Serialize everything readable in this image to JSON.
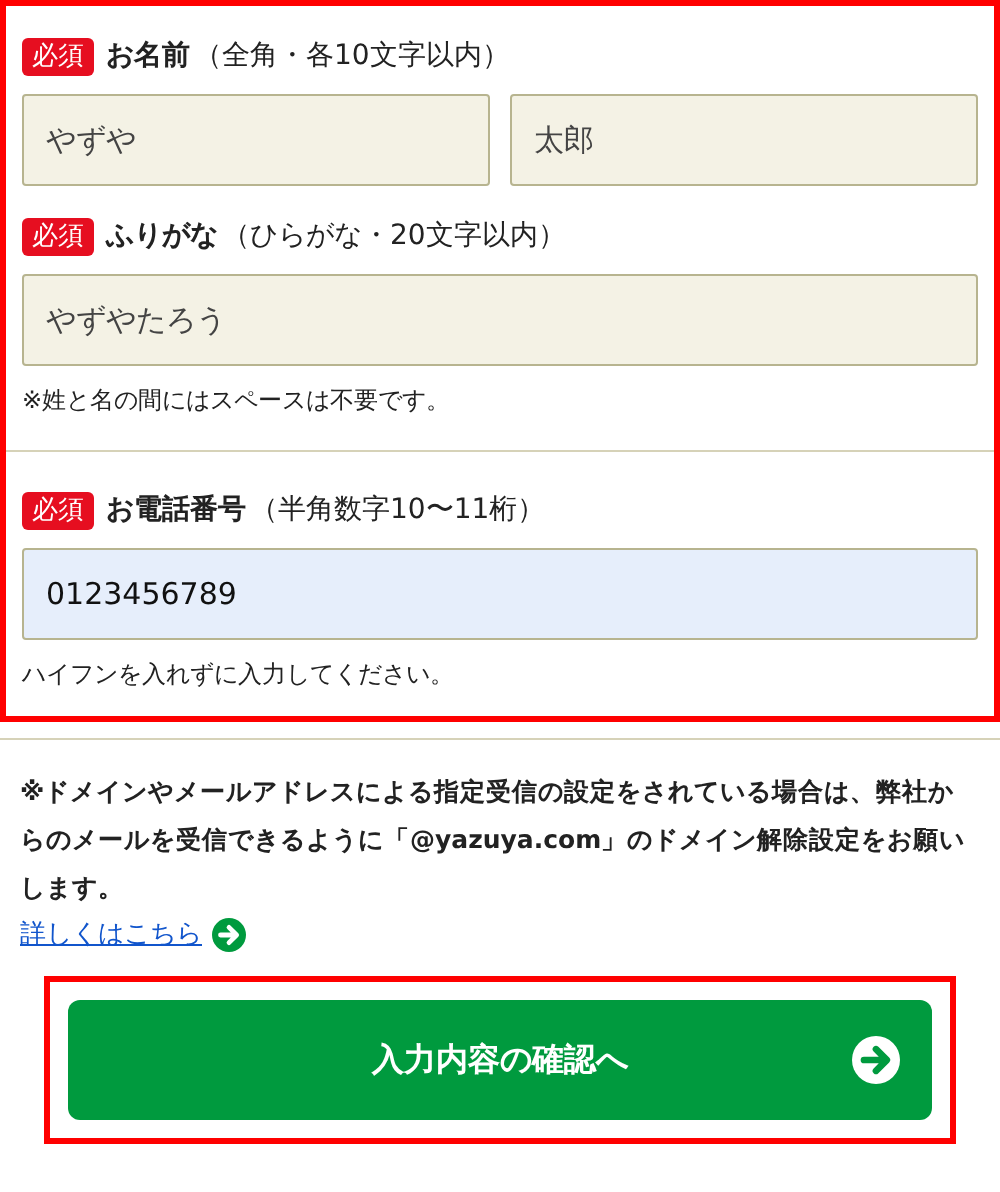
{
  "sections": [
    {
      "required_badge": "必須",
      "label": "お名前",
      "hint": "（全角・各10文字以内）",
      "fields": [
        {
          "value": "やずや",
          "focused": false
        },
        {
          "value": "太郎",
          "focused": false
        }
      ]
    },
    {
      "required_badge": "必須",
      "label": "ふりがな",
      "hint": "（ひらがな・20文字以内）",
      "fields": [
        {
          "value": "やずやたろう",
          "focused": false
        }
      ],
      "note": "※姓と名の間にはスペースは不要です。"
    },
    {
      "required_badge": "必須",
      "label": "お電話番号",
      "hint": "（半角数字10〜11桁）",
      "fields": [
        {
          "value": "0123456789",
          "focused": true
        }
      ],
      "note": "ハイフンを入れずに入力してください。"
    }
  ],
  "notice": "※ドメインやメールアドレスによる指定受信の設定をされている場合は、弊社からのメールを受信できるように「@yazuya.com」のドメイン解除設定をお願いします。",
  "details_link": "詳しくはこちら",
  "submit_button": "入力内容の確認へ"
}
